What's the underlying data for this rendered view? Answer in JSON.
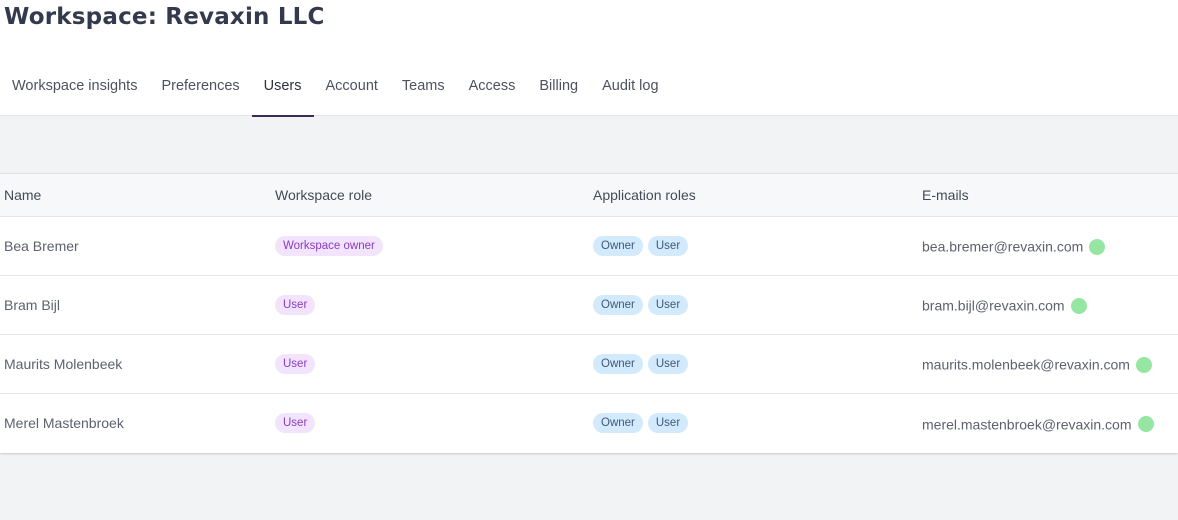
{
  "header": {
    "title": "Workspace: Revaxin LLC"
  },
  "tabs": [
    {
      "label": "Workspace insights",
      "active": false
    },
    {
      "label": "Preferences",
      "active": false
    },
    {
      "label": "Users",
      "active": true
    },
    {
      "label": "Account",
      "active": false
    },
    {
      "label": "Teams",
      "active": false
    },
    {
      "label": "Access",
      "active": false
    },
    {
      "label": "Billing",
      "active": false
    },
    {
      "label": "Audit log",
      "active": false
    }
  ],
  "table": {
    "columns": [
      "Name",
      "Workspace role",
      "Application roles",
      "E-mails"
    ],
    "rows": [
      {
        "name": "Bea Bremer",
        "workspace_role": "Workspace owner",
        "app_roles": [
          "Owner",
          "User"
        ],
        "email": "bea.bremer@revaxin.com",
        "status": "verified"
      },
      {
        "name": "Bram Bijl",
        "workspace_role": "User",
        "app_roles": [
          "Owner",
          "User"
        ],
        "email": "bram.bijl@revaxin.com",
        "status": "verified"
      },
      {
        "name": "Maurits Molenbeek",
        "workspace_role": "User",
        "app_roles": [
          "Owner",
          "User"
        ],
        "email": "maurits.molenbeek@revaxin.com",
        "status": "verified"
      },
      {
        "name": "Merel Mastenbroek",
        "workspace_role": "User",
        "app_roles": [
          "Owner",
          "User"
        ],
        "email": "merel.mastenbroek@revaxin.com",
        "status": "verified"
      }
    ]
  },
  "colors": {
    "tab_active_underline": "#3d2a57",
    "workspace_role_badge_bg": "#f1e4fc",
    "workspace_role_badge_text": "#8a3cc4",
    "app_role_badge_bg": "#d3eafc",
    "app_role_badge_text": "#3e5a7a",
    "status_dot": "#95e6a2"
  }
}
